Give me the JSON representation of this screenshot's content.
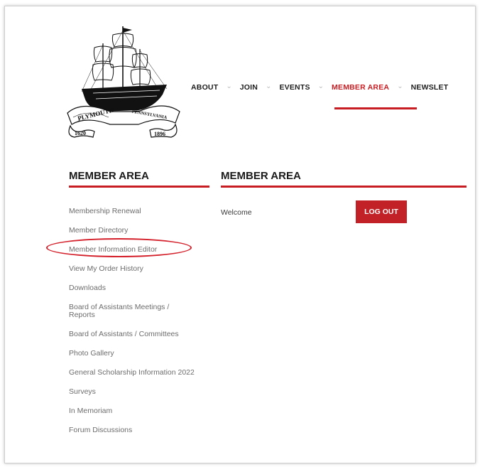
{
  "header": {
    "logo": {
      "name": "Plymouth ship seal",
      "text": [
        "PLYMOUTH",
        "PENNSYLVANIA",
        "1620",
        "1896"
      ]
    },
    "nav": [
      {
        "label": "ABOUT",
        "active": false
      },
      {
        "label": "JOIN",
        "active": false
      },
      {
        "label": "EVENTS",
        "active": false
      },
      {
        "label": "MEMBER AREA",
        "active": true
      },
      {
        "label": "NEWSLET",
        "active": false
      }
    ],
    "separator_glyph": "⌄"
  },
  "sidebar": {
    "title": "MEMBER AREA",
    "items": [
      {
        "label": "Membership Renewal"
      },
      {
        "label": "Member Directory"
      },
      {
        "label": "Member Information Editor",
        "highlighted": true
      },
      {
        "label": "View My Order History"
      },
      {
        "label": "Downloads"
      },
      {
        "label": "Board of Assistants Meetings / Reports"
      },
      {
        "label": "Board of Assistants / Committees"
      },
      {
        "label": "Photo Gallery"
      },
      {
        "label": "General Scholarship Information 2022"
      },
      {
        "label": "Surveys"
      },
      {
        "label": "In Memoriam"
      },
      {
        "label": "Forum Discussions"
      }
    ]
  },
  "main": {
    "title": "MEMBER AREA",
    "welcome": "Welcome",
    "logout_label": "LOG OUT"
  },
  "colors": {
    "accent_red": "#c81e23",
    "button_red": "#c12127",
    "text_dark": "#1b1b1b",
    "text_muted": "#6d6d6d",
    "annotation_red": "#d4202a"
  }
}
